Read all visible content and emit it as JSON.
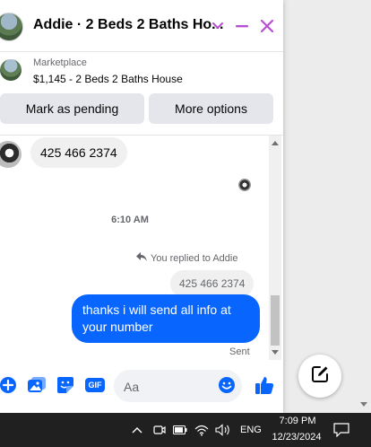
{
  "colors": {
    "accent": "#0866ff",
    "header_icons": "#b64fd3",
    "bubble_in": "#f0f0f0",
    "taskbar": "#202020"
  },
  "header": {
    "title": "Addie · 2 Beds 2 Baths Ho...",
    "icons": [
      "chevron-down-icon",
      "minimize-icon",
      "close-icon"
    ]
  },
  "listing": {
    "label": "Marketplace",
    "price_title": "$1,145 - 2 Beds 2 Baths House"
  },
  "actions": {
    "mark_pending": "Mark as pending",
    "more_options": "More options"
  },
  "messages": {
    "incoming_1": "425 466 2374",
    "timestamp": "6:10 AM",
    "replied_note": "You replied to Addie",
    "quoted": "425 466 2374",
    "outgoing_1": "thanks i will send all info at your number",
    "status": "Sent"
  },
  "composer": {
    "placeholder": "Aa",
    "icons": [
      "add-icon",
      "photo-icon",
      "sticker-icon",
      "gif-icon",
      "emoji-icon",
      "thumbs-up-icon"
    ],
    "gif_label": "GIF"
  },
  "taskbar": {
    "language": "ENG",
    "time": "7:09 PM",
    "date": "12/23/2024"
  }
}
